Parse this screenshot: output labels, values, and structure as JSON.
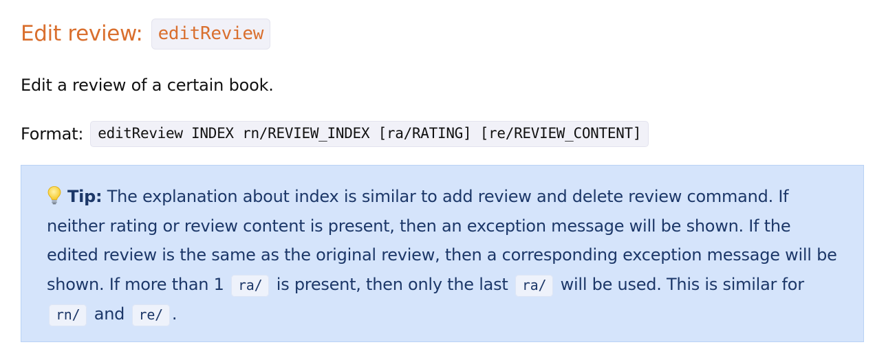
{
  "heading": {
    "text": "Edit review:",
    "code": "editReview"
  },
  "description": "Edit a review of a certain book.",
  "format": {
    "label": "Format:",
    "code": "editReview INDEX rn/REVIEW_INDEX [ra/RATING] [re/REVIEW_CONTENT]"
  },
  "tip": {
    "icon": "lightbulb-icon",
    "label": "Tip:",
    "text_1": " The explanation about index is similar to add review and delete review command. If neither rating or review content is present, then an exception message will be shown. If the edited review is the same as the original review, then a corresponding exception message will be shown. If more than 1 ",
    "code_1": "ra/",
    "text_2": " is present, then only the last ",
    "code_2": "ra/",
    "text_3": " will be used. This is similar for ",
    "code_3": "rn/",
    "text_4": " and ",
    "code_4": "re/",
    "text_5": "."
  },
  "colors": {
    "heading": "#d96f2e",
    "tip_background": "#d5e4fb",
    "tip_text": "#1c3768"
  }
}
